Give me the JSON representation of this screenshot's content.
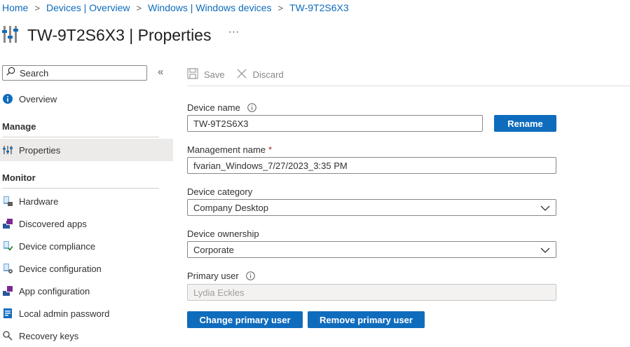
{
  "breadcrumb": [
    "Home",
    "Devices | Overview",
    "Windows | Windows devices",
    "TW-9T2S6X3"
  ],
  "header": {
    "title": "TW-9T2S6X3 | Properties",
    "more": "···"
  },
  "sidebar": {
    "search_placeholder": "Search",
    "collapse": "«",
    "items": [
      {
        "label": "Overview",
        "icon": "info-icon"
      },
      {
        "section": "Manage"
      },
      {
        "label": "Properties",
        "icon": "properties-icon",
        "selected": true
      },
      {
        "section": "Monitor"
      },
      {
        "label": "Hardware",
        "icon": "hardware-icon"
      },
      {
        "label": "Discovered apps",
        "icon": "discovered-apps-icon"
      },
      {
        "label": "Device compliance",
        "icon": "device-compliance-icon"
      },
      {
        "label": "Device configuration",
        "icon": "device-configuration-icon"
      },
      {
        "label": "App configuration",
        "icon": "app-configuration-icon"
      },
      {
        "label": "Local admin password",
        "icon": "local-admin-password-icon"
      },
      {
        "label": "Recovery keys",
        "icon": "recovery-keys-icon"
      }
    ]
  },
  "toolbar": {
    "save_label": "Save",
    "discard_label": "Discard"
  },
  "form": {
    "device_name": {
      "label": "Device name",
      "value": "TW-9T2S6X3",
      "button": "Rename"
    },
    "management_name": {
      "label": "Management name",
      "required": "*",
      "value": "fvarian_Windows_7/27/2023_3:35 PM"
    },
    "device_category": {
      "label": "Device category",
      "value": "Company Desktop"
    },
    "device_ownership": {
      "label": "Device ownership",
      "value": "Corporate"
    },
    "primary_user": {
      "label": "Primary user",
      "value": "Lydia Eckles"
    },
    "change_primary_user": "Change primary user",
    "remove_primary_user": "Remove primary user"
  },
  "colors": {
    "accent": "#0f6cbd",
    "selected_bg": "#edebe9",
    "text": "#323130"
  }
}
